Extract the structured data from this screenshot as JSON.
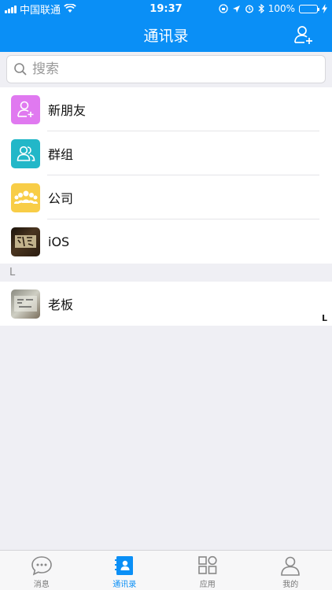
{
  "status": {
    "carrier": "中国联通",
    "time": "19:37",
    "battery": "100%",
    "battery_level": 1.0
  },
  "navbar": {
    "title": "通讯录",
    "add_icon": "add-contact-icon"
  },
  "search": {
    "placeholder": "搜索"
  },
  "list": {
    "items": [
      {
        "label": "新朋友",
        "icon": "add-person-icon",
        "color": "#e079f0"
      },
      {
        "label": "群组",
        "icon": "group-icon",
        "color": "#22b7c8"
      },
      {
        "label": "公司",
        "icon": "company-icon",
        "color": "#f8cd47"
      },
      {
        "label": "iOS",
        "icon": "photo-avatar",
        "color": "#3a2a18"
      }
    ]
  },
  "section": {
    "letter": "L"
  },
  "contacts": [
    {
      "label": "老板",
      "icon": "photo-avatar"
    }
  ],
  "index": {
    "letter": "L"
  },
  "tabbar": {
    "tabs": [
      {
        "label": "消息",
        "icon": "chat-bubble-icon"
      },
      {
        "label": "通讯录",
        "icon": "contacts-book-icon",
        "active": true
      },
      {
        "label": "应用",
        "icon": "apps-grid-icon"
      },
      {
        "label": "我的",
        "icon": "profile-icon"
      }
    ]
  },
  "colors": {
    "accent": "#0a8ff6",
    "background": "#efeff4"
  }
}
